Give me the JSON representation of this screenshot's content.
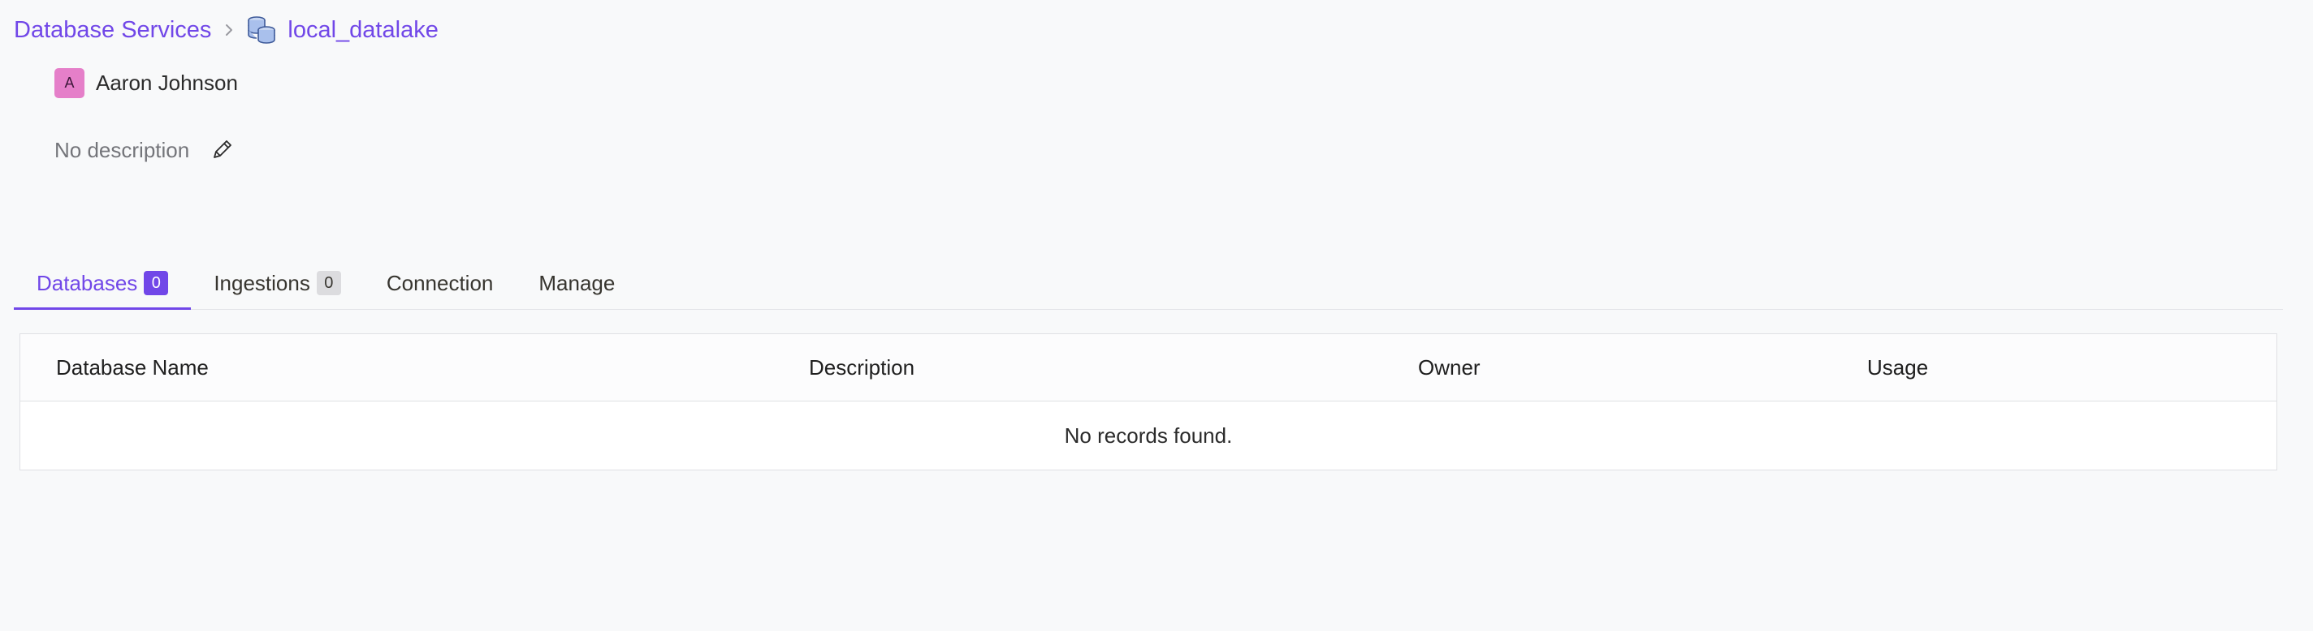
{
  "breadcrumb": {
    "parent_label": "Database Services",
    "current_label": "local_datalake",
    "current_icon": "database-stack-icon"
  },
  "owner": {
    "avatar_initial": "A",
    "name": "Aaron Johnson"
  },
  "description": {
    "text": "No description",
    "edit_icon": "pencil-icon"
  },
  "tabs": [
    {
      "label": "Databases",
      "count": "0"
    },
    {
      "label": "Ingestions",
      "count": "0"
    },
    {
      "label": "Connection"
    },
    {
      "label": "Manage"
    }
  ],
  "table": {
    "columns": [
      "Database Name",
      "Description",
      "Owner",
      "Usage"
    ],
    "empty_message": "No records found."
  },
  "colors": {
    "accent": "#7147e8",
    "avatar_bg": "#e57fc9",
    "background": "#f8f9fa"
  }
}
